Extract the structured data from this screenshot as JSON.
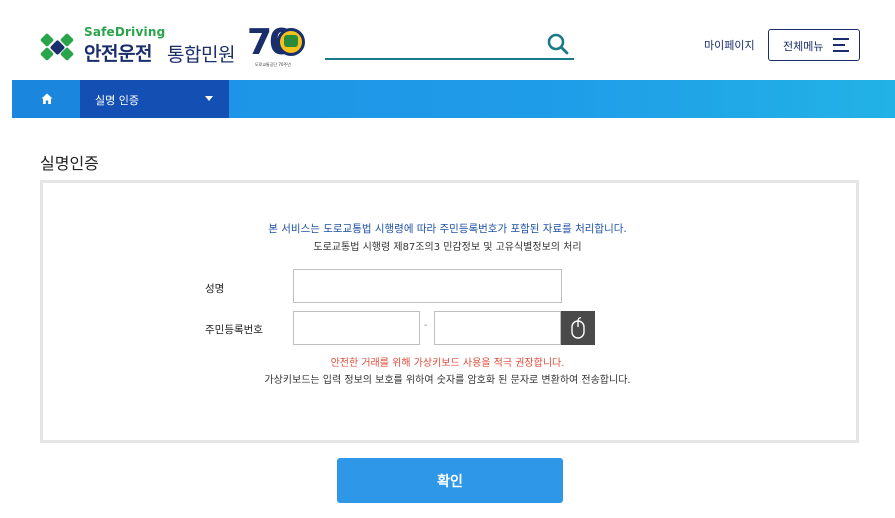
{
  "brand": {
    "logo_sub": "SafeDriving",
    "logo_main": "안전운전",
    "logo_main2": "통합민원",
    "anniversary_number": "70",
    "anniversary_caption": "도로교통공단 70주년",
    "colors": {
      "navy": "#1a2e6b",
      "green": "#2aa44a"
    }
  },
  "header": {
    "search_icon": "search-icon",
    "mypage_label": "마이페이지",
    "allmenu_label": "전체메뉴",
    "allmenu_icon": "hamburger-icon"
  },
  "nav": {
    "home_icon": "home-icon",
    "current_menu": "실명 인증",
    "colors": {
      "bar": "#1f9ce8",
      "active": "#1450b4"
    }
  },
  "page": {
    "title": "실명인증"
  },
  "form": {
    "notice_blue": "본 서비스는 도로교통법 시행령에 따라 주민등록번호가 포함된 자료를 처리합니다.",
    "notice_sub": "도로교통법 시행령 제87조의3 민감정보 및 고유식별정보의 처리",
    "name_label": "성명",
    "name_value": "",
    "rrn_label": "주민등록번호",
    "rrn_front_value": "",
    "rrn_back_value": "",
    "rrn_separator": "-",
    "keyboard_icon": "mouse-icon",
    "warning_red": "안전한 거래를 위해 가상키보드 사용을 적극 권장합니다.",
    "warning_sub": "가상키보드는 입력 정보의 보호를 위하여 숫자를 암호화 된 문자로 변환하여 전송합니다.",
    "confirm_label": "확인",
    "colors": {
      "warning": "#e04b3a",
      "notice": "#1f52a3",
      "button": "#2e97e8"
    }
  }
}
